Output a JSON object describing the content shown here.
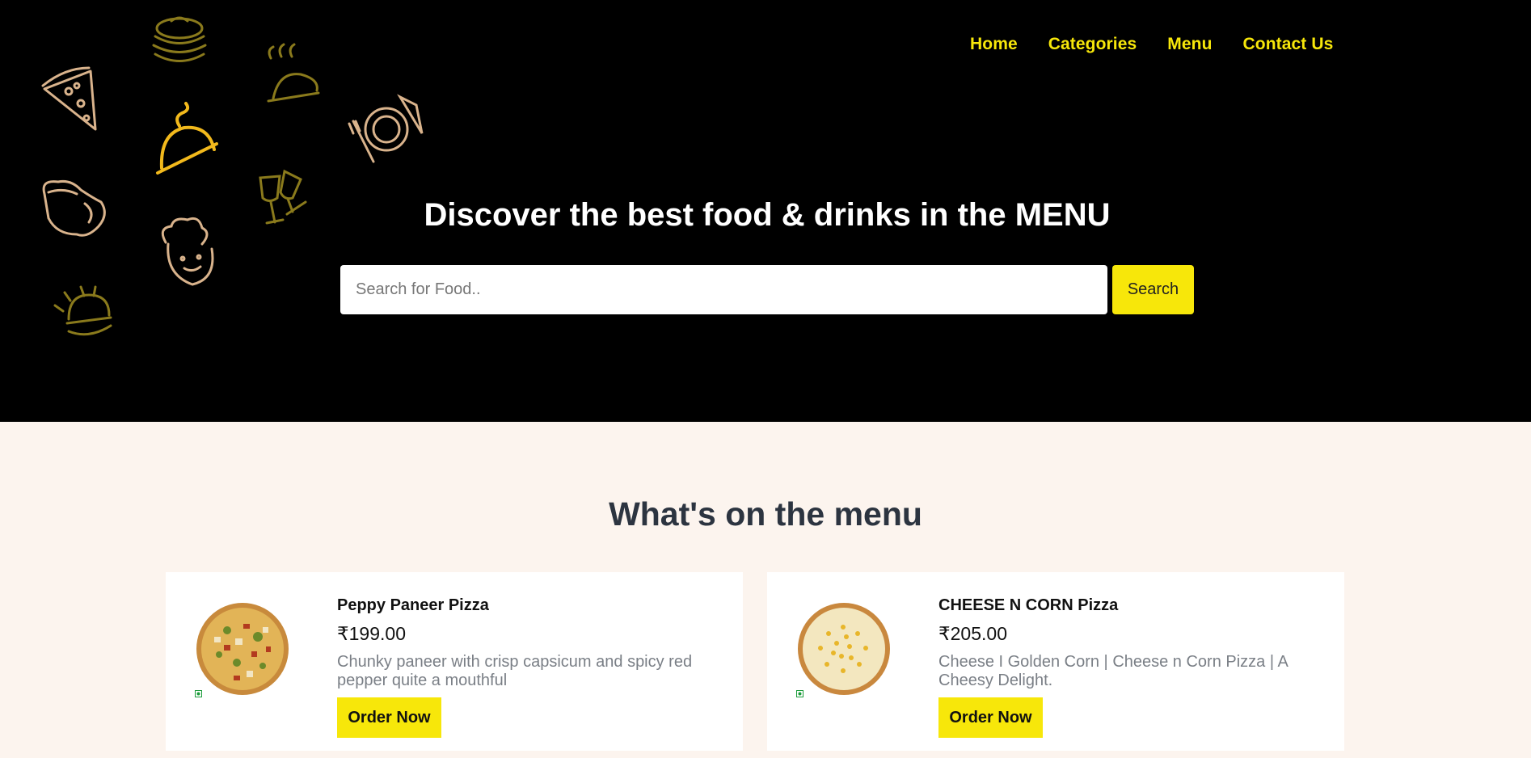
{
  "nav": {
    "items": [
      "Home",
      "Categories",
      "Menu",
      "Contact Us"
    ]
  },
  "hero": {
    "title": "Discover the best food & drinks in the MENU",
    "search_placeholder": "Search for Food..",
    "search_button": "Search",
    "doodle_icons": [
      "pizza-slice-icon",
      "pancakes-icon",
      "cloche-icon",
      "plate-cutlery-icon",
      "chicken-icon",
      "glasses-icon",
      "chef-icon",
      "burger-icon"
    ]
  },
  "menu": {
    "title": "What's on the menu",
    "items": [
      {
        "name": "Peppy Paneer Pizza",
        "price": "₹199.00",
        "description": "Chunky paneer with crisp capsicum and spicy red pepper quite a mouthful",
        "order_label": "Order Now",
        "veg": true
      },
      {
        "name": "CHEESE N CORN Pizza",
        "price": "₹205.00",
        "description": "Cheese I Golden Corn | Cheese n Corn Pizza | A Cheesy Delight.",
        "order_label": "Order Now",
        "veg": true
      }
    ]
  },
  "colors": {
    "accent": "#f7e70a",
    "hero_bg": "#000000",
    "page_bg": "#fcf4ee",
    "heading": "#2c3440",
    "desc": "#7a7f86"
  }
}
